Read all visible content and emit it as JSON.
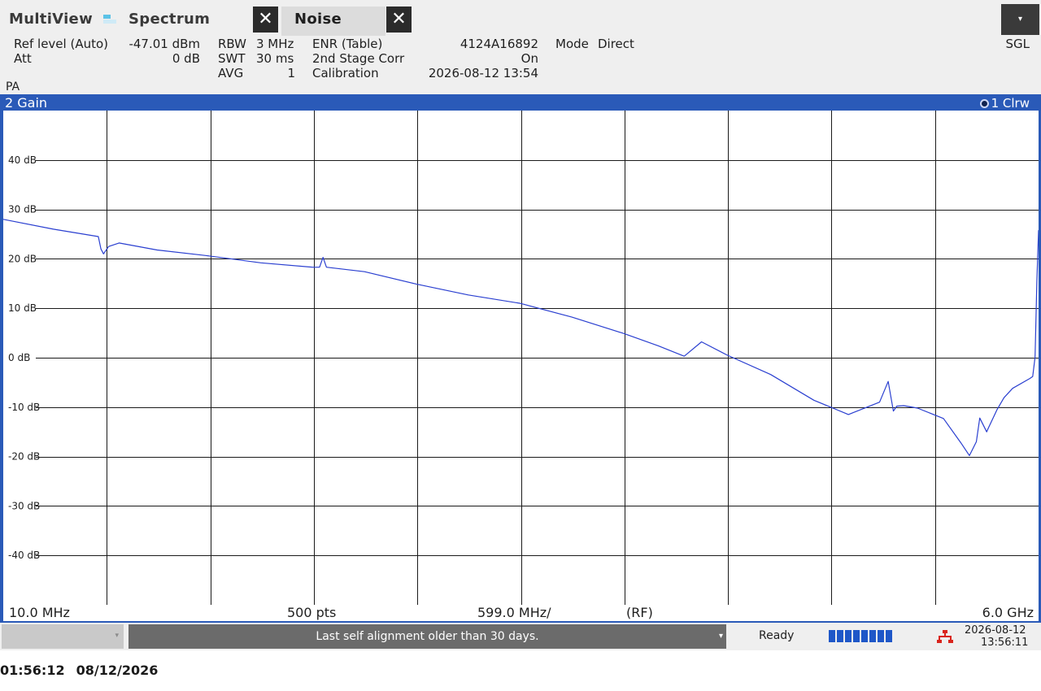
{
  "tabs": {
    "multiview": "MultiView",
    "spectrum": "Spectrum",
    "noise": "Noise",
    "close_glyph": "✕",
    "menu_glyph": "▾"
  },
  "settings": {
    "ref_level_label": "Ref level (Auto)",
    "ref_level_value": "-47.01 dBm",
    "att_label": "Att",
    "att_value": "0 dB",
    "rbw_label": "RBW",
    "rbw_value": "3 MHz",
    "swt_label": "SWT",
    "swt_value": "30 ms",
    "avg_label": "AVG",
    "avg_value": "1",
    "enr_label": "ENR (Table)",
    "enr_value": "4124A16892",
    "stage_label": "2nd Stage Corr",
    "stage_value": "On",
    "cal_label": "Calibration",
    "cal_value": "2026-08-12 13:54",
    "mode_label": "Mode",
    "mode_value": "Direct",
    "sgl": "SGL",
    "pa": "PA"
  },
  "diagram": {
    "title": "2 Gain",
    "trace_label": "1 Clrw",
    "start": "10.0 MHz",
    "points": "500 pts",
    "span_div": "599.0 MHz/",
    "rf": "(RF)",
    "stop": "6.0 GHz"
  },
  "chart_data": {
    "type": "line",
    "x_unit": "MHz",
    "xlim": [
      10,
      6000
    ],
    "ylim": [
      -50,
      50
    ],
    "grid": true,
    "y_ticks": [
      "40 dB",
      "30 dB",
      "20 dB",
      "10 dB",
      "0 dB",
      "-10 dB",
      "-20 dB",
      "-30 dB",
      "-40 dB"
    ],
    "y_tick_values": [
      40,
      30,
      20,
      10,
      0,
      -10,
      -20,
      -30,
      -40
    ],
    "x": [
      10,
      300,
      560,
      575,
      590,
      620,
      680,
      900,
      1200,
      1500,
      1800,
      1840,
      1860,
      1880,
      2100,
      2400,
      2700,
      3000,
      3300,
      3600,
      3800,
      3950,
      4050,
      4200,
      4450,
      4700,
      4900,
      5080,
      5130,
      5160,
      5180,
      5220,
      5300,
      5450,
      5550,
      5600,
      5640,
      5660,
      5700,
      5710,
      5760,
      5800,
      5850,
      5950,
      5966,
      5980,
      5990,
      6000
    ],
    "y": [
      28,
      26,
      24.5,
      22,
      21,
      22.5,
      23.2,
      21.8,
      20.6,
      19.2,
      18.3,
      18.3,
      20.3,
      18.3,
      17.4,
      14.9,
      12.7,
      11.0,
      8.2,
      4.9,
      2.4,
      0.3,
      3.2,
      0.5,
      -3.4,
      -8.6,
      -11.5,
      -9.0,
      -4.8,
      -10.8,
      -9.8,
      -9.7,
      -10.2,
      -12.3,
      -17.2,
      -19.8,
      -17.0,
      -12.2,
      -15.0,
      -14.2,
      -10.5,
      -8.1,
      -6.2,
      -4.2,
      -3.8,
      0.1,
      15.4,
      25.8
    ]
  },
  "status": {
    "message": "Last self alignment older than 30 days.",
    "dropdown_glyph": "▾",
    "ready": "Ready",
    "date": "2026-08-12",
    "time": "13:56:11"
  },
  "footer": {
    "time": "01:56:12",
    "date": "08/12/2026"
  }
}
